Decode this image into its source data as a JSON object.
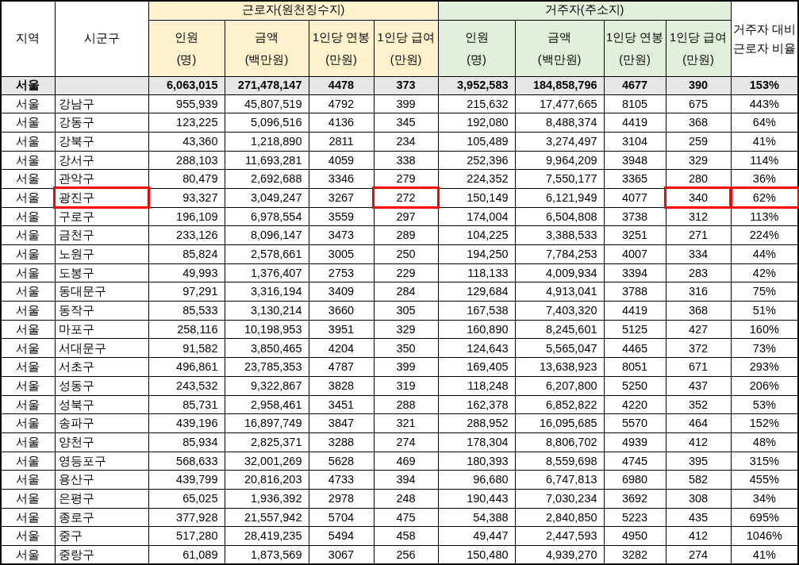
{
  "table": {
    "columns": [
      {
        "label": "지역"
      },
      {
        "label": "시군구"
      }
    ],
    "groups": [
      {
        "label": "근로자(원천징수지)",
        "columns": [
          {
            "label": "인원",
            "unit": "(명)"
          },
          {
            "label": "금액",
            "unit": "(백만원)"
          },
          {
            "label": "1인당 연봉",
            "unit": "(만원)"
          },
          {
            "label": "1인당 급여",
            "unit": "(만원)"
          }
        ]
      },
      {
        "label": "거주자(주소지)",
        "columns": [
          {
            "label": "인원",
            "unit": "(명)"
          },
          {
            "label": "금액",
            "unit": "(백만원)"
          },
          {
            "label": "1인당 연봉",
            "unit": "(만원)"
          },
          {
            "label": "1인당 급여",
            "unit": "(만원)"
          }
        ]
      }
    ],
    "ratio_column": {
      "lines": [
        "거주자 대비",
        "근로자 비율"
      ]
    },
    "total_row": {
      "cells": [
        "서울",
        "",
        "6,063,015",
        "271,478,147",
        "4478",
        "373",
        "3,952,583",
        "184,858,796",
        "4677",
        "390",
        "153%"
      ]
    },
    "rows": [
      {
        "cells": [
          "서울",
          "강남구",
          "955,939",
          "45,807,519",
          "4792",
          "399",
          "215,632",
          "17,477,665",
          "8105",
          "675",
          "443%"
        ],
        "marked": [
          false,
          false,
          false,
          false,
          false,
          false,
          false,
          false,
          false,
          false,
          false
        ]
      },
      {
        "cells": [
          "서울",
          "강동구",
          "123,225",
          "5,096,516",
          "4136",
          "345",
          "192,080",
          "8,488,374",
          "4419",
          "368",
          "64%"
        ],
        "marked": [
          false,
          false,
          false,
          false,
          false,
          false,
          false,
          false,
          false,
          false,
          false
        ]
      },
      {
        "cells": [
          "서울",
          "강북구",
          "43,360",
          "1,218,890",
          "2811",
          "234",
          "105,489",
          "3,274,497",
          "3104",
          "259",
          "41%"
        ],
        "marked": [
          false,
          false,
          false,
          false,
          false,
          false,
          false,
          false,
          false,
          false,
          false
        ]
      },
      {
        "cells": [
          "서울",
          "강서구",
          "288,103",
          "11,693,281",
          "4059",
          "338",
          "252,396",
          "9,964,209",
          "3948",
          "329",
          "114%"
        ],
        "marked": [
          false,
          false,
          false,
          false,
          false,
          false,
          false,
          false,
          false,
          false,
          false
        ]
      },
      {
        "cells": [
          "서울",
          "관악구",
          "80,479",
          "2,692,688",
          "3346",
          "279",
          "224,352",
          "7,550,177",
          "3365",
          "280",
          "36%"
        ],
        "marked": [
          false,
          false,
          false,
          false,
          false,
          false,
          false,
          false,
          false,
          false,
          false
        ]
      },
      {
        "cells": [
          "서울",
          "광진구",
          "93,327",
          "3,049,247",
          "3267",
          "272",
          "150,149",
          "6,121,949",
          "4077",
          "340",
          "62%"
        ],
        "marked": [
          false,
          true,
          false,
          false,
          false,
          true,
          false,
          false,
          false,
          true,
          true
        ]
      },
      {
        "cells": [
          "서울",
          "구로구",
          "196,109",
          "6,978,554",
          "3559",
          "297",
          "174,004",
          "6,504,808",
          "3738",
          "312",
          "113%"
        ],
        "marked": [
          false,
          false,
          false,
          false,
          false,
          false,
          false,
          false,
          false,
          false,
          false
        ]
      },
      {
        "cells": [
          "서울",
          "금천구",
          "233,126",
          "8,096,147",
          "3473",
          "289",
          "104,225",
          "3,388,533",
          "3251",
          "271",
          "224%"
        ],
        "marked": [
          false,
          false,
          false,
          false,
          false,
          false,
          false,
          false,
          false,
          false,
          false
        ]
      },
      {
        "cells": [
          "서울",
          "노원구",
          "85,824",
          "2,578,661",
          "3005",
          "250",
          "194,250",
          "7,784,253",
          "4007",
          "334",
          "44%"
        ],
        "marked": [
          false,
          false,
          false,
          false,
          false,
          false,
          false,
          false,
          false,
          false,
          false
        ]
      },
      {
        "cells": [
          "서울",
          "도봉구",
          "49,993",
          "1,376,407",
          "2753",
          "229",
          "118,133",
          "4,009,934",
          "3394",
          "283",
          "42%"
        ],
        "marked": [
          false,
          false,
          false,
          false,
          false,
          false,
          false,
          false,
          false,
          false,
          false
        ]
      },
      {
        "cells": [
          "서울",
          "동대문구",
          "97,291",
          "3,316,194",
          "3409",
          "284",
          "129,684",
          "4,913,041",
          "3788",
          "316",
          "75%"
        ],
        "marked": [
          false,
          false,
          false,
          false,
          false,
          false,
          false,
          false,
          false,
          false,
          false
        ]
      },
      {
        "cells": [
          "서울",
          "동작구",
          "85,533",
          "3,130,214",
          "3660",
          "305",
          "167,538",
          "7,403,320",
          "4419",
          "368",
          "51%"
        ],
        "marked": [
          false,
          false,
          false,
          false,
          false,
          false,
          false,
          false,
          false,
          false,
          false
        ]
      },
      {
        "cells": [
          "서울",
          "마포구",
          "258,116",
          "10,198,953",
          "3951",
          "329",
          "160,890",
          "8,245,601",
          "5125",
          "427",
          "160%"
        ],
        "marked": [
          false,
          false,
          false,
          false,
          false,
          false,
          false,
          false,
          false,
          false,
          false
        ]
      },
      {
        "cells": [
          "서울",
          "서대문구",
          "91,582",
          "3,850,465",
          "4204",
          "350",
          "124,643",
          "5,565,047",
          "4465",
          "372",
          "73%"
        ],
        "marked": [
          false,
          false,
          false,
          false,
          false,
          false,
          false,
          false,
          false,
          false,
          false
        ]
      },
      {
        "cells": [
          "서울",
          "서초구",
          "496,861",
          "23,785,353",
          "4787",
          "399",
          "169,405",
          "13,638,923",
          "8051",
          "671",
          "293%"
        ],
        "marked": [
          false,
          false,
          false,
          false,
          false,
          false,
          false,
          false,
          false,
          false,
          false
        ]
      },
      {
        "cells": [
          "서울",
          "성동구",
          "243,532",
          "9,322,867",
          "3828",
          "319",
          "118,248",
          "6,207,800",
          "5250",
          "437",
          "206%"
        ],
        "marked": [
          false,
          false,
          false,
          false,
          false,
          false,
          false,
          false,
          false,
          false,
          false
        ]
      },
      {
        "cells": [
          "서울",
          "성북구",
          "85,731",
          "2,958,461",
          "3451",
          "288",
          "162,378",
          "6,852,822",
          "4220",
          "352",
          "53%"
        ],
        "marked": [
          false,
          false,
          false,
          false,
          false,
          false,
          false,
          false,
          false,
          false,
          false
        ]
      },
      {
        "cells": [
          "서울",
          "송파구",
          "439,196",
          "16,897,749",
          "3847",
          "321",
          "288,952",
          "16,095,685",
          "5570",
          "464",
          "152%"
        ],
        "marked": [
          false,
          false,
          false,
          false,
          false,
          false,
          false,
          false,
          false,
          false,
          false
        ]
      },
      {
        "cells": [
          "서울",
          "양천구",
          "85,934",
          "2,825,371",
          "3288",
          "274",
          "178,304",
          "8,806,702",
          "4939",
          "412",
          "48%"
        ],
        "marked": [
          false,
          false,
          false,
          false,
          false,
          false,
          false,
          false,
          false,
          false,
          false
        ]
      },
      {
        "cells": [
          "서울",
          "영등포구",
          "568,633",
          "32,001,269",
          "5628",
          "469",
          "180,393",
          "8,559,698",
          "4745",
          "395",
          "315%"
        ],
        "marked": [
          false,
          false,
          false,
          false,
          false,
          false,
          false,
          false,
          false,
          false,
          false
        ]
      },
      {
        "cells": [
          "서울",
          "용산구",
          "439,799",
          "20,816,203",
          "4733",
          "394",
          "96,680",
          "6,747,813",
          "6980",
          "582",
          "455%"
        ],
        "marked": [
          false,
          false,
          false,
          false,
          false,
          false,
          false,
          false,
          false,
          false,
          false
        ]
      },
      {
        "cells": [
          "서울",
          "은평구",
          "65,025",
          "1,936,392",
          "2978",
          "248",
          "190,443",
          "7,030,234",
          "3692",
          "308",
          "34%"
        ],
        "marked": [
          false,
          false,
          false,
          false,
          false,
          false,
          false,
          false,
          false,
          false,
          false
        ]
      },
      {
        "cells": [
          "서울",
          "종로구",
          "377,928",
          "21,557,942",
          "5704",
          "475",
          "54,388",
          "2,840,850",
          "5223",
          "435",
          "695%"
        ],
        "marked": [
          false,
          false,
          false,
          false,
          false,
          false,
          false,
          false,
          false,
          false,
          false
        ]
      },
      {
        "cells": [
          "서울",
          "중구",
          "517,280",
          "28,419,235",
          "5494",
          "458",
          "49,447",
          "2,447,593",
          "4950",
          "412",
          "1046%"
        ],
        "marked": [
          false,
          false,
          false,
          false,
          false,
          false,
          false,
          false,
          false,
          false,
          false
        ]
      },
      {
        "cells": [
          "서울",
          "중랑구",
          "61,089",
          "1,873,569",
          "3067",
          "256",
          "150,480",
          "4,939,270",
          "3282",
          "274",
          "41%"
        ],
        "marked": [
          false,
          false,
          false,
          false,
          false,
          false,
          false,
          false,
          false,
          false,
          false
        ]
      }
    ]
  }
}
